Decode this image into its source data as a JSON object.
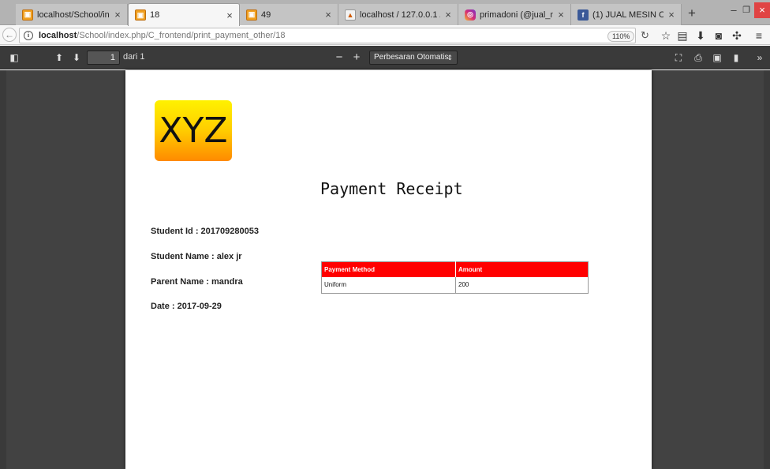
{
  "browser": {
    "tabs": [
      {
        "label": "localhost/School/index.p",
        "favicon": "school-favicon",
        "active": false
      },
      {
        "label": "18",
        "favicon": "school-favicon",
        "active": true
      },
      {
        "label": "49",
        "favicon": "school-favicon",
        "active": false
      },
      {
        "label": "localhost / 127.0.0.1 / sch",
        "favicon": "phpmyadmin-favicon",
        "active": false
      },
      {
        "label": "primadoni (@jual_mesin",
        "favicon": "instagram-favicon",
        "active": false
      },
      {
        "label": "(1) JUAL MESIN Copotan",
        "favicon": "facebook-favicon",
        "active": false
      }
    ],
    "tab_close_glyph": "×",
    "new_tab_glyph": "+",
    "window": {
      "minimize": "–",
      "maximize": "❐",
      "close": "×"
    },
    "address": {
      "host": "localhost",
      "path": "/School/index.php/C_frontend/print_payment_other/18",
      "zoom": "110%"
    }
  },
  "pdf_toolbar": {
    "page_number": "1",
    "page_of": "dari 1",
    "zoom_minus": "−",
    "zoom_plus": "+",
    "zoom_selected": "Perbesaran Otomatis"
  },
  "document": {
    "logo_text": "XYZ",
    "title": "Payment Receipt",
    "student_id": "Student Id : 201709280053",
    "student_name": "Student Name : alex jr",
    "parent_name": "Parent Name : mandra",
    "date": "Date : 2017-09-29",
    "table": {
      "headers": [
        "Payment Method",
        "Amount"
      ],
      "rows": [
        [
          "Uniform",
          "200"
        ]
      ]
    }
  },
  "colors": {
    "table_header": "#ff0000",
    "pdf_background": "#424242",
    "pdf_toolbar": "#3a3a3a",
    "tab_strip": "#b3b3b3"
  }
}
